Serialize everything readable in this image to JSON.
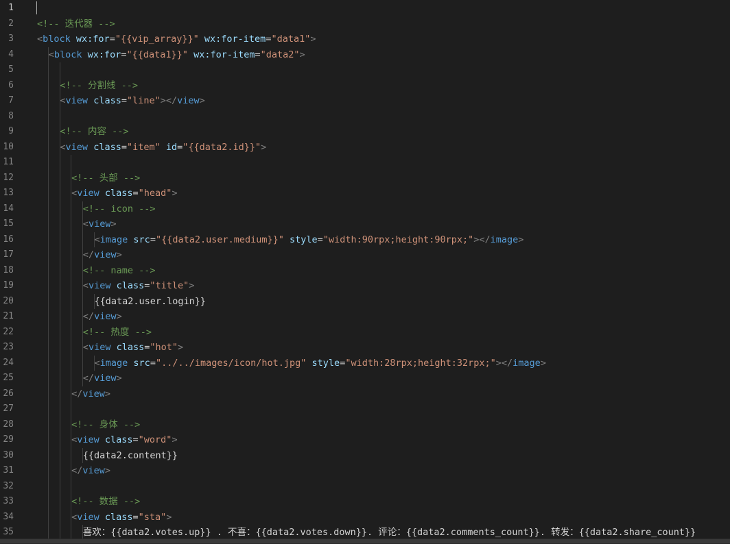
{
  "editor": {
    "active_line": 1,
    "lines": [
      {
        "n": "1",
        "indent": 0,
        "tokens": []
      },
      {
        "n": "2",
        "indent": 0,
        "tokens": [
          {
            "t": "cm",
            "v": "<!-- 迭代器 -->"
          }
        ]
      },
      {
        "n": "3",
        "indent": 0,
        "tokens": [
          {
            "t": "punc",
            "v": "<"
          },
          {
            "t": "tag",
            "v": "block"
          },
          {
            "t": "pl",
            "v": " "
          },
          {
            "t": "attr",
            "v": "wx:for"
          },
          {
            "t": "pl",
            "v": "="
          },
          {
            "t": "str",
            "v": "\"{{vip_array}}\""
          },
          {
            "t": "pl",
            "v": " "
          },
          {
            "t": "attr",
            "v": "wx:for-item"
          },
          {
            "t": "pl",
            "v": "="
          },
          {
            "t": "str",
            "v": "\"data1\""
          },
          {
            "t": "punc",
            "v": ">"
          }
        ]
      },
      {
        "n": "4",
        "indent": 1,
        "tokens": [
          {
            "t": "punc",
            "v": "<"
          },
          {
            "t": "tag",
            "v": "block"
          },
          {
            "t": "pl",
            "v": " "
          },
          {
            "t": "attr",
            "v": "wx:for"
          },
          {
            "t": "pl",
            "v": "="
          },
          {
            "t": "str",
            "v": "\"{{data1}}\""
          },
          {
            "t": "pl",
            "v": " "
          },
          {
            "t": "attr",
            "v": "wx:for-item"
          },
          {
            "t": "pl",
            "v": "="
          },
          {
            "t": "str",
            "v": "\"data2\""
          },
          {
            "t": "punc",
            "v": ">"
          }
        ]
      },
      {
        "n": "5",
        "indent": 2,
        "tokens": []
      },
      {
        "n": "6",
        "indent": 2,
        "tokens": [
          {
            "t": "cm",
            "v": "<!-- 分割线 -->"
          }
        ]
      },
      {
        "n": "7",
        "indent": 2,
        "tokens": [
          {
            "t": "punc",
            "v": "<"
          },
          {
            "t": "tag",
            "v": "view"
          },
          {
            "t": "pl",
            "v": " "
          },
          {
            "t": "attr",
            "v": "class"
          },
          {
            "t": "pl",
            "v": "="
          },
          {
            "t": "str",
            "v": "\"line\""
          },
          {
            "t": "punc",
            "v": "></"
          },
          {
            "t": "tag",
            "v": "view"
          },
          {
            "t": "punc",
            "v": ">"
          }
        ]
      },
      {
        "n": "8",
        "indent": 2,
        "tokens": []
      },
      {
        "n": "9",
        "indent": 2,
        "tokens": [
          {
            "t": "cm",
            "v": "<!-- 内容 -->"
          }
        ]
      },
      {
        "n": "10",
        "indent": 2,
        "tokens": [
          {
            "t": "punc",
            "v": "<"
          },
          {
            "t": "tag",
            "v": "view"
          },
          {
            "t": "pl",
            "v": " "
          },
          {
            "t": "attr",
            "v": "class"
          },
          {
            "t": "pl",
            "v": "="
          },
          {
            "t": "str",
            "v": "\"item\""
          },
          {
            "t": "pl",
            "v": " "
          },
          {
            "t": "attr",
            "v": "id"
          },
          {
            "t": "pl",
            "v": "="
          },
          {
            "t": "str",
            "v": "\"{{data2.id}}\""
          },
          {
            "t": "punc",
            "v": ">"
          }
        ]
      },
      {
        "n": "11",
        "indent": 3,
        "tokens": []
      },
      {
        "n": "12",
        "indent": 3,
        "tokens": [
          {
            "t": "cm",
            "v": "<!-- 头部 -->"
          }
        ]
      },
      {
        "n": "13",
        "indent": 3,
        "tokens": [
          {
            "t": "punc",
            "v": "<"
          },
          {
            "t": "tag",
            "v": "view"
          },
          {
            "t": "pl",
            "v": " "
          },
          {
            "t": "attr",
            "v": "class"
          },
          {
            "t": "pl",
            "v": "="
          },
          {
            "t": "str",
            "v": "\"head\""
          },
          {
            "t": "punc",
            "v": ">"
          }
        ]
      },
      {
        "n": "14",
        "indent": 4,
        "tokens": [
          {
            "t": "cm",
            "v": "<!-- icon -->"
          }
        ]
      },
      {
        "n": "15",
        "indent": 4,
        "tokens": [
          {
            "t": "punc",
            "v": "<"
          },
          {
            "t": "tag",
            "v": "view"
          },
          {
            "t": "punc",
            "v": ">"
          }
        ]
      },
      {
        "n": "16",
        "indent": 5,
        "tokens": [
          {
            "t": "punc",
            "v": "<"
          },
          {
            "t": "tag",
            "v": "image"
          },
          {
            "t": "pl",
            "v": " "
          },
          {
            "t": "attr",
            "v": "src"
          },
          {
            "t": "pl",
            "v": "="
          },
          {
            "t": "str",
            "v": "\"{{data2.user.medium}}\""
          },
          {
            "t": "pl",
            "v": " "
          },
          {
            "t": "attr",
            "v": "style"
          },
          {
            "t": "pl",
            "v": "="
          },
          {
            "t": "str",
            "v": "\"width:90rpx;height:90rpx;\""
          },
          {
            "t": "punc",
            "v": "></"
          },
          {
            "t": "tag",
            "v": "image"
          },
          {
            "t": "punc",
            "v": ">"
          }
        ]
      },
      {
        "n": "17",
        "indent": 4,
        "tokens": [
          {
            "t": "punc",
            "v": "</"
          },
          {
            "t": "tag",
            "v": "view"
          },
          {
            "t": "punc",
            "v": ">"
          }
        ]
      },
      {
        "n": "18",
        "indent": 4,
        "tokens": [
          {
            "t": "cm",
            "v": "<!-- name -->"
          }
        ]
      },
      {
        "n": "19",
        "indent": 4,
        "tokens": [
          {
            "t": "punc",
            "v": "<"
          },
          {
            "t": "tag",
            "v": "view"
          },
          {
            "t": "pl",
            "v": " "
          },
          {
            "t": "attr",
            "v": "class"
          },
          {
            "t": "pl",
            "v": "="
          },
          {
            "t": "str",
            "v": "\"title\""
          },
          {
            "t": "punc",
            "v": ">"
          }
        ]
      },
      {
        "n": "20",
        "indent": 5,
        "tokens": [
          {
            "t": "pl",
            "v": "{{data2.user.login}}"
          }
        ]
      },
      {
        "n": "21",
        "indent": 4,
        "tokens": [
          {
            "t": "punc",
            "v": "</"
          },
          {
            "t": "tag",
            "v": "view"
          },
          {
            "t": "punc",
            "v": ">"
          }
        ]
      },
      {
        "n": "22",
        "indent": 4,
        "tokens": [
          {
            "t": "cm",
            "v": "<!-- 热度 -->"
          }
        ]
      },
      {
        "n": "23",
        "indent": 4,
        "tokens": [
          {
            "t": "punc",
            "v": "<"
          },
          {
            "t": "tag",
            "v": "view"
          },
          {
            "t": "pl",
            "v": " "
          },
          {
            "t": "attr",
            "v": "class"
          },
          {
            "t": "pl",
            "v": "="
          },
          {
            "t": "str",
            "v": "\"hot\""
          },
          {
            "t": "punc",
            "v": ">"
          }
        ]
      },
      {
        "n": "24",
        "indent": 5,
        "tokens": [
          {
            "t": "punc",
            "v": "<"
          },
          {
            "t": "tag",
            "v": "image"
          },
          {
            "t": "pl",
            "v": " "
          },
          {
            "t": "attr",
            "v": "src"
          },
          {
            "t": "pl",
            "v": "="
          },
          {
            "t": "str",
            "v": "\"../../images/icon/hot.jpg\""
          },
          {
            "t": "pl",
            "v": " "
          },
          {
            "t": "attr",
            "v": "style"
          },
          {
            "t": "pl",
            "v": "="
          },
          {
            "t": "str",
            "v": "\"width:28rpx;height:32rpx;\""
          },
          {
            "t": "punc",
            "v": "></"
          },
          {
            "t": "tag",
            "v": "image"
          },
          {
            "t": "punc",
            "v": ">"
          }
        ]
      },
      {
        "n": "25",
        "indent": 4,
        "tokens": [
          {
            "t": "punc",
            "v": "</"
          },
          {
            "t": "tag",
            "v": "view"
          },
          {
            "t": "punc",
            "v": ">"
          }
        ]
      },
      {
        "n": "26",
        "indent": 3,
        "tokens": [
          {
            "t": "punc",
            "v": "</"
          },
          {
            "t": "tag",
            "v": "view"
          },
          {
            "t": "punc",
            "v": ">"
          }
        ]
      },
      {
        "n": "27",
        "indent": 3,
        "tokens": []
      },
      {
        "n": "28",
        "indent": 3,
        "tokens": [
          {
            "t": "cm",
            "v": "<!-- 身体 -->"
          }
        ]
      },
      {
        "n": "29",
        "indent": 3,
        "tokens": [
          {
            "t": "punc",
            "v": "<"
          },
          {
            "t": "tag",
            "v": "view"
          },
          {
            "t": "pl",
            "v": " "
          },
          {
            "t": "attr",
            "v": "class"
          },
          {
            "t": "pl",
            "v": "="
          },
          {
            "t": "str",
            "v": "\"word\""
          },
          {
            "t": "punc",
            "v": ">"
          }
        ]
      },
      {
        "n": "30",
        "indent": 4,
        "tokens": [
          {
            "t": "pl",
            "v": "{{data2.content}}"
          }
        ]
      },
      {
        "n": "31",
        "indent": 3,
        "tokens": [
          {
            "t": "punc",
            "v": "</"
          },
          {
            "t": "tag",
            "v": "view"
          },
          {
            "t": "punc",
            "v": ">"
          }
        ]
      },
      {
        "n": "32",
        "indent": 3,
        "tokens": []
      },
      {
        "n": "33",
        "indent": 3,
        "tokens": [
          {
            "t": "cm",
            "v": "<!-- 数据 -->"
          }
        ]
      },
      {
        "n": "34",
        "indent": 3,
        "tokens": [
          {
            "t": "punc",
            "v": "<"
          },
          {
            "t": "tag",
            "v": "view"
          },
          {
            "t": "pl",
            "v": " "
          },
          {
            "t": "attr",
            "v": "class"
          },
          {
            "t": "pl",
            "v": "="
          },
          {
            "t": "str",
            "v": "\"sta\""
          },
          {
            "t": "punc",
            "v": ">"
          }
        ]
      },
      {
        "n": "35",
        "indent": 4,
        "tokens": [
          {
            "t": "pl",
            "v": "喜欢：{{data2.votes.up}} . 不喜：{{data2.votes.down}}. 评论：{{data2.comments_count}}. 转发：{{data2.share_count}}"
          }
        ]
      }
    ]
  }
}
